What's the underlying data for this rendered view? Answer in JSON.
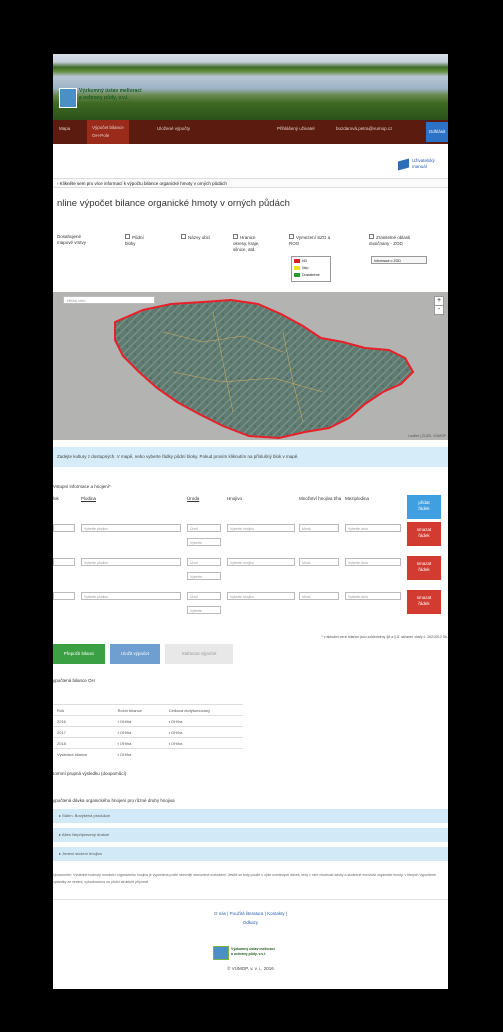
{
  "header": {
    "logo_text_1": "Výzkumný ústav meliorací",
    "logo_text_2": "a ochrany půdy, v.v.i."
  },
  "nav": {
    "items": [
      "Mapa",
      "Výpočet bilance",
      "Uložené výpočty"
    ],
    "active_sub": "OH-Pole",
    "user": "Přihlášený uživatel",
    "email": "bozdarová.petra@vumop.cz",
    "login": "Odhlásit"
  },
  "manual": "Uživatelský manuál",
  "info1": "Klikněte sem pro více informací k výpočtu bilance organické hmoty v orných půdách",
  "title": "nline výpočet bilance organické hmoty v orných půdách",
  "layers": {
    "a": [
      "Dosahujené",
      "mapové vrstvy"
    ],
    "b": [
      "Půdní",
      "bloky"
    ],
    "c": "Názvy obcí",
    "d": [
      "Hranice",
      "okresy, kraje,",
      "silnice, atd."
    ],
    "e": [
      "Vymezení SZO a",
      "ROO"
    ],
    "f": [
      "Zranitelné oblasti",
      "dusičnany - ZOD"
    ]
  },
  "legend": {
    "items": [
      "ND",
      "Nep",
      "Dostatečné"
    ],
    "colors": [
      "#e02020",
      "#f0e020",
      "#2a9a2a"
    ]
  },
  "zod_btn": "Informace o ZOD",
  "map": {
    "search_placeholder": "Hledej obec",
    "zoom_in": "+",
    "zoom_out": "-",
    "attrib": "Leaflet | ČÚZK, VÚMOP"
  },
  "info2": "Zadejte kultury z dostupných. V mapě, nebo vyberte řádky půdní bloky. Pokud prosím kliknutím na příslušný blok v mapě.",
  "section_title": "Vstupní informace a hnojení*",
  "cols": [
    "lok",
    "Plodina",
    "Úroda",
    "Hnojivo",
    "Množství hnojiva t/ha",
    "Meziplodina"
  ],
  "btn_add": [
    "přidat",
    "řádek"
  ],
  "btn_del": [
    "smazat",
    "řádek"
  ],
  "row": {
    "crop": "Vyberte plodinu",
    "yield": "Úrod",
    "yield2": "Vyberte",
    "fert": "Vyberte hnojivo",
    "amount": "Množ.",
    "catch": "Vyberte druh"
  },
  "footnote": "* v aktuální verzi bilance jsou zohledněny §8 a §11 nařízení vlády č. 262/2012 Sb.",
  "actions": {
    "compute": "Přepočti bilanci",
    "save": "Uložit výpočet",
    "download": "Stáhnout výpočet"
  },
  "result_title": "ypočtená bilance OH",
  "table": {
    "headers": [
      "Rok",
      "Roční bilance",
      "Celková zbdýtumovaný"
    ],
    "rows": [
      [
        "2016",
        "t OH/ha",
        "t OH/ha"
      ],
      [
        "2017",
        "t OH/ha",
        "t OH/ha"
      ],
      [
        "2018",
        "t OH/ha",
        "t OH/ha"
      ],
      [
        "Výsledná bilance",
        "t OH/ha",
        ""
      ]
    ]
  },
  "report": "Iormní prupná výsledku (doupomůcí)",
  "dose_title": "ypočtená dávka organického hnojení pro různé druhy hnojiva",
  "acc": [
    "Stáhn. Bovýšená produkce",
    "Alten Nepřipravený drašné",
    "Jedení složení hnojiva"
  ],
  "note": "Upozornění: Výsledné hodnoty množství organického hnojiva je vypočtená podle obecnějí stanovené metodami. Jestliž se tedy použe o výše uvedených dávek, tedy v nich vhodnost dávky a skutečné množstvi orgánicke hmoty, v kterých Vypočtené výsledky ze vedeni, vyhodnoceno na půdní struktuře přípravě.",
  "links": [
    "O nás",
    "Použitá literatura",
    "Kontakty",
    "Odkazy"
  ],
  "footer_logo": [
    "Výzkumný ústav meliorací",
    "a ochrany půdy, v.v.i."
  ],
  "copyright": "© VÚMOP, v. v. i., 2016"
}
